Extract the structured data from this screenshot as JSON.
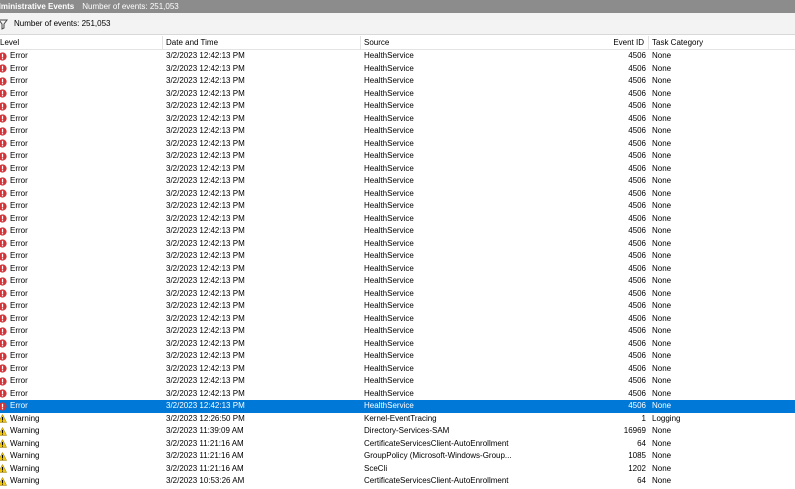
{
  "window": {
    "title": "dministrative Events",
    "event_count_text": "Number of events: 251,053"
  },
  "filter_bar": {
    "event_count_text": "Number of events: 251,053"
  },
  "columns": {
    "level": "Level",
    "date_time": "Date and Time",
    "source": "Source",
    "event_id": "Event ID",
    "task_category": "Task Category"
  },
  "colors": {
    "selection": "#0078d7",
    "error_icon": "#d13438",
    "warning_icon": "#f2c811",
    "titlebar": "#8c8c8c"
  },
  "rows": [
    {
      "level": "Error",
      "icon": "error-icon",
      "date": "3/2/2023 12:42:13 PM",
      "source": "HealthService",
      "event_id": "4506",
      "task": "None"
    },
    {
      "level": "Error",
      "icon": "error-icon",
      "date": "3/2/2023 12:42:13 PM",
      "source": "HealthService",
      "event_id": "4506",
      "task": "None"
    },
    {
      "level": "Error",
      "icon": "error-icon",
      "date": "3/2/2023 12:42:13 PM",
      "source": "HealthService",
      "event_id": "4506",
      "task": "None"
    },
    {
      "level": "Error",
      "icon": "error-icon",
      "date": "3/2/2023 12:42:13 PM",
      "source": "HealthService",
      "event_id": "4506",
      "task": "None"
    },
    {
      "level": "Error",
      "icon": "error-icon",
      "date": "3/2/2023 12:42:13 PM",
      "source": "HealthService",
      "event_id": "4506",
      "task": "None"
    },
    {
      "level": "Error",
      "icon": "error-icon",
      "date": "3/2/2023 12:42:13 PM",
      "source": "HealthService",
      "event_id": "4506",
      "task": "None"
    },
    {
      "level": "Error",
      "icon": "error-icon",
      "date": "3/2/2023 12:42:13 PM",
      "source": "HealthService",
      "event_id": "4506",
      "task": "None"
    },
    {
      "level": "Error",
      "icon": "error-icon",
      "date": "3/2/2023 12:42:13 PM",
      "source": "HealthService",
      "event_id": "4506",
      "task": "None"
    },
    {
      "level": "Error",
      "icon": "error-icon",
      "date": "3/2/2023 12:42:13 PM",
      "source": "HealthService",
      "event_id": "4506",
      "task": "None"
    },
    {
      "level": "Error",
      "icon": "error-icon",
      "date": "3/2/2023 12:42:13 PM",
      "source": "HealthService",
      "event_id": "4506",
      "task": "None"
    },
    {
      "level": "Error",
      "icon": "error-icon",
      "date": "3/2/2023 12:42:13 PM",
      "source": "HealthService",
      "event_id": "4506",
      "task": "None"
    },
    {
      "level": "Error",
      "icon": "error-icon",
      "date": "3/2/2023 12:42:13 PM",
      "source": "HealthService",
      "event_id": "4506",
      "task": "None"
    },
    {
      "level": "Error",
      "icon": "error-icon",
      "date": "3/2/2023 12:42:13 PM",
      "source": "HealthService",
      "event_id": "4506",
      "task": "None"
    },
    {
      "level": "Error",
      "icon": "error-icon",
      "date": "3/2/2023 12:42:13 PM",
      "source": "HealthService",
      "event_id": "4506",
      "task": "None"
    },
    {
      "level": "Error",
      "icon": "error-icon",
      "date": "3/2/2023 12:42:13 PM",
      "source": "HealthService",
      "event_id": "4506",
      "task": "None"
    },
    {
      "level": "Error",
      "icon": "error-icon",
      "date": "3/2/2023 12:42:13 PM",
      "source": "HealthService",
      "event_id": "4506",
      "task": "None"
    },
    {
      "level": "Error",
      "icon": "error-icon",
      "date": "3/2/2023 12:42:13 PM",
      "source": "HealthService",
      "event_id": "4506",
      "task": "None"
    },
    {
      "level": "Error",
      "icon": "error-icon",
      "date": "3/2/2023 12:42:13 PM",
      "source": "HealthService",
      "event_id": "4506",
      "task": "None"
    },
    {
      "level": "Error",
      "icon": "error-icon",
      "date": "3/2/2023 12:42:13 PM",
      "source": "HealthService",
      "event_id": "4506",
      "task": "None"
    },
    {
      "level": "Error",
      "icon": "error-icon",
      "date": "3/2/2023 12:42:13 PM",
      "source": "HealthService",
      "event_id": "4506",
      "task": "None"
    },
    {
      "level": "Error",
      "icon": "error-icon",
      "date": "3/2/2023 12:42:13 PM",
      "source": "HealthService",
      "event_id": "4506",
      "task": "None"
    },
    {
      "level": "Error",
      "icon": "error-icon",
      "date": "3/2/2023 12:42:13 PM",
      "source": "HealthService",
      "event_id": "4506",
      "task": "None"
    },
    {
      "level": "Error",
      "icon": "error-icon",
      "date": "3/2/2023 12:42:13 PM",
      "source": "HealthService",
      "event_id": "4506",
      "task": "None"
    },
    {
      "level": "Error",
      "icon": "error-icon",
      "date": "3/2/2023 12:42:13 PM",
      "source": "HealthService",
      "event_id": "4506",
      "task": "None"
    },
    {
      "level": "Error",
      "icon": "error-icon",
      "date": "3/2/2023 12:42:13 PM",
      "source": "HealthService",
      "event_id": "4506",
      "task": "None"
    },
    {
      "level": "Error",
      "icon": "error-icon",
      "date": "3/2/2023 12:42:13 PM",
      "source": "HealthService",
      "event_id": "4506",
      "task": "None"
    },
    {
      "level": "Error",
      "icon": "error-icon",
      "date": "3/2/2023 12:42:13 PM",
      "source": "HealthService",
      "event_id": "4506",
      "task": "None"
    },
    {
      "level": "Error",
      "icon": "error-icon",
      "date": "3/2/2023 12:42:13 PM",
      "source": "HealthService",
      "event_id": "4506",
      "task": "None"
    },
    {
      "level": "Error",
      "icon": "error-icon",
      "date": "3/2/2023 12:42:13 PM",
      "source": "HealthService",
      "event_id": "4506",
      "task": "None",
      "selected": true
    },
    {
      "level": "Warning",
      "icon": "warning-icon",
      "date": "3/2/2023 12:26:50 PM",
      "source": "Kernel-EventTracing",
      "event_id": "1",
      "task": "Logging"
    },
    {
      "level": "Warning",
      "icon": "warning-icon",
      "date": "3/2/2023 11:39:09 AM",
      "source": "Directory-Services-SAM",
      "event_id": "16969",
      "task": "None"
    },
    {
      "level": "Warning",
      "icon": "warning-icon",
      "date": "3/2/2023 11:21:16 AM",
      "source": "CertificateServicesClient-AutoEnrollment",
      "event_id": "64",
      "task": "None"
    },
    {
      "level": "Warning",
      "icon": "warning-icon",
      "date": "3/2/2023 11:21:16 AM",
      "source": "GroupPolicy (Microsoft-Windows-Group...",
      "event_id": "1085",
      "task": "None"
    },
    {
      "level": "Warning",
      "icon": "warning-icon",
      "date": "3/2/2023 11:21:16 AM",
      "source": "SceCli",
      "event_id": "1202",
      "task": "None"
    },
    {
      "level": "Warning",
      "icon": "warning-icon",
      "date": "3/2/2023 10:53:26 AM",
      "source": "CertificateServicesClient-AutoEnrollment",
      "event_id": "64",
      "task": "None"
    }
  ]
}
